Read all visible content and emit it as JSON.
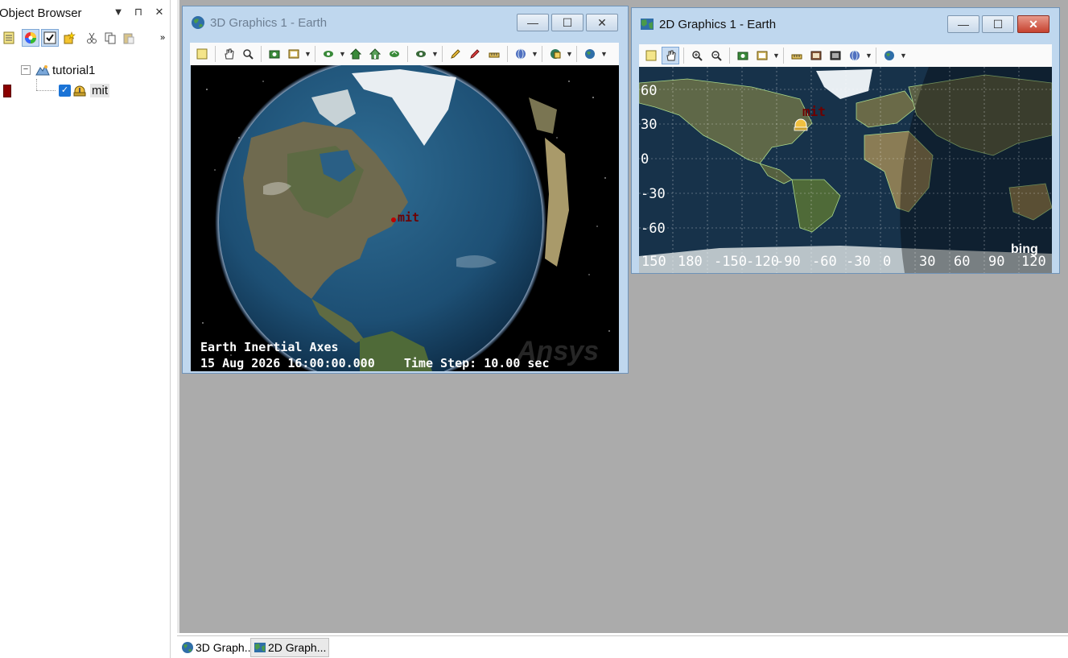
{
  "object_browser": {
    "title": "Object Browser",
    "controls": {
      "menu": "▼",
      "pin": "⊓",
      "close": "✕"
    },
    "overflow": "»",
    "tree": {
      "root": {
        "label": "tutorial1",
        "expander": "−"
      },
      "child": {
        "label": "mit"
      }
    }
  },
  "window3d": {
    "title": "3D Graphics 1 - Earth",
    "overlay_line1": "Earth Inertial Axes",
    "overlay_line2": "15 Aug 2026 16:00:00.000    Time Step: 10.00 sec",
    "watermark": "Ansys",
    "facility_label": "mit"
  },
  "window2d": {
    "title": "2D Graphics 1 - Earth",
    "facility_label": "mit",
    "bing": "bing",
    "lat_labels": [
      "60",
      "30",
      "0",
      "-30",
      "-60"
    ],
    "lon_labels": [
      "150",
      "180",
      "-150",
      "-120",
      "-90",
      "-60",
      "-30",
      "0",
      "30",
      "60",
      "90",
      "120"
    ]
  },
  "tabs": [
    {
      "label": "3D Graph..."
    },
    {
      "label": "2D Graph..."
    }
  ],
  "colors": {
    "mdi_background": "#ababab",
    "window_frame": "#bfd7ee",
    "close_button": "#c6422f",
    "facility_label": "#6e0000",
    "checkbox": "#1a73d6"
  }
}
